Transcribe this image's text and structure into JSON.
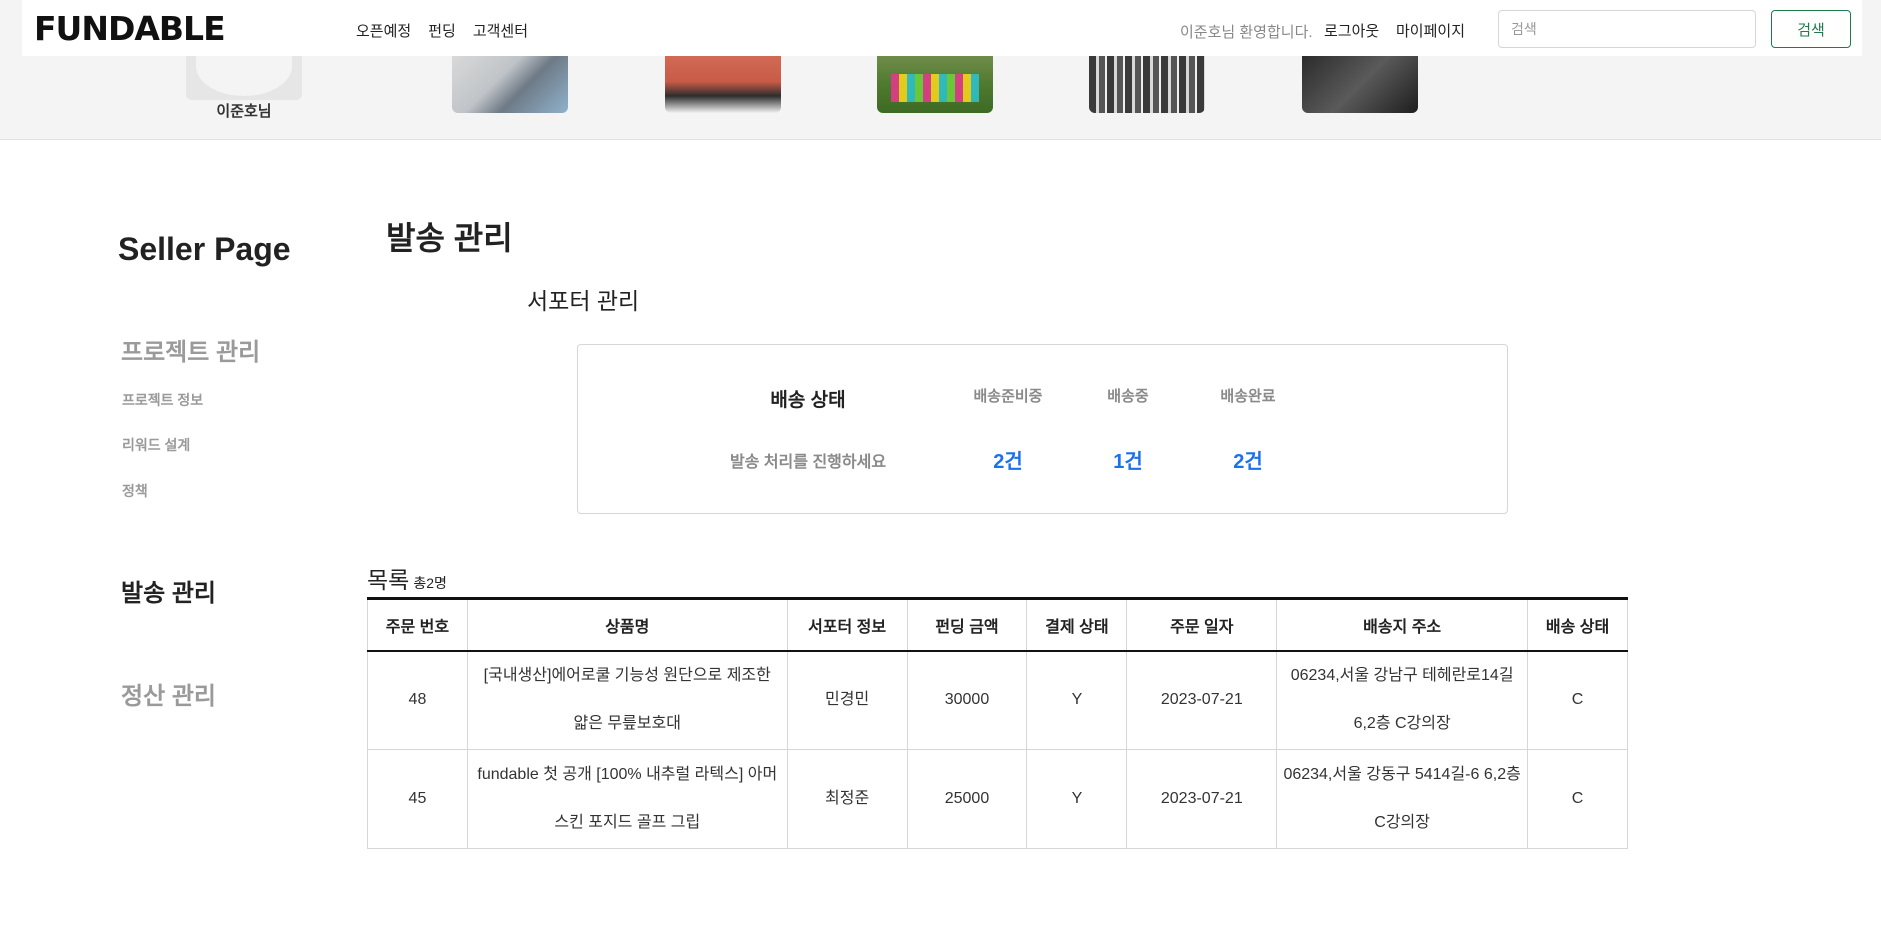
{
  "header": {
    "logo": "FUNDABLE",
    "nav": [
      "오픈예정",
      "펀딩",
      "고객센터"
    ],
    "welcome": "이준호님 환영합니다.",
    "logout": "로그아웃",
    "mypage": "마이페이지",
    "search_placeholder": "검색",
    "search_button": "검색"
  },
  "banner": {
    "avatar_name": "이준호님"
  },
  "sidebar": {
    "title": "Seller Page",
    "project_mgmt": "프로젝트 관리",
    "project_items": [
      "프로젝트 정보",
      "리워드 설계",
      "정책"
    ],
    "shipping_mgmt": "발송 관리",
    "settlement_mgmt": "정산 관리"
  },
  "main": {
    "page_title": "발송 관리",
    "sub_title": "서포터 관리",
    "status_box": {
      "label": "배송 상태",
      "hint": "발송 처리를 진행하세요",
      "columns": [
        {
          "header": "배송준비중",
          "value": "2건"
        },
        {
          "header": "배송중",
          "value": "1건"
        },
        {
          "header": "배송완료",
          "value": "2건"
        }
      ]
    },
    "list": {
      "title": "목록",
      "count": "총2명",
      "columns": [
        "주문 번호",
        "상품명",
        "서포터 정보",
        "펀딩 금액",
        "결제 상태",
        "주문 일자",
        "배송지 주소",
        "배송 상태"
      ],
      "rows": [
        {
          "order_no": "48",
          "product": "[국내생산]에어로쿨 기능성 원단으로 제조한 얇은 무릎보호대",
          "supporter": "민경민",
          "amount": "30000",
          "payment": "Y",
          "date": "2023-07-21",
          "address": "06234,서울 강남구 테헤란로14길 6,2층 C강의장",
          "status": "C"
        },
        {
          "order_no": "45",
          "product": "fundable 첫 공개 [100% 내추럴 라텍스] 아머스킨 포지드 골프 그립",
          "supporter": "최정준",
          "amount": "25000",
          "payment": "Y",
          "date": "2023-07-21",
          "address": "06234,서울 강동구 5414길-6 6,2층 C강의장",
          "status": "C"
        }
      ]
    }
  }
}
